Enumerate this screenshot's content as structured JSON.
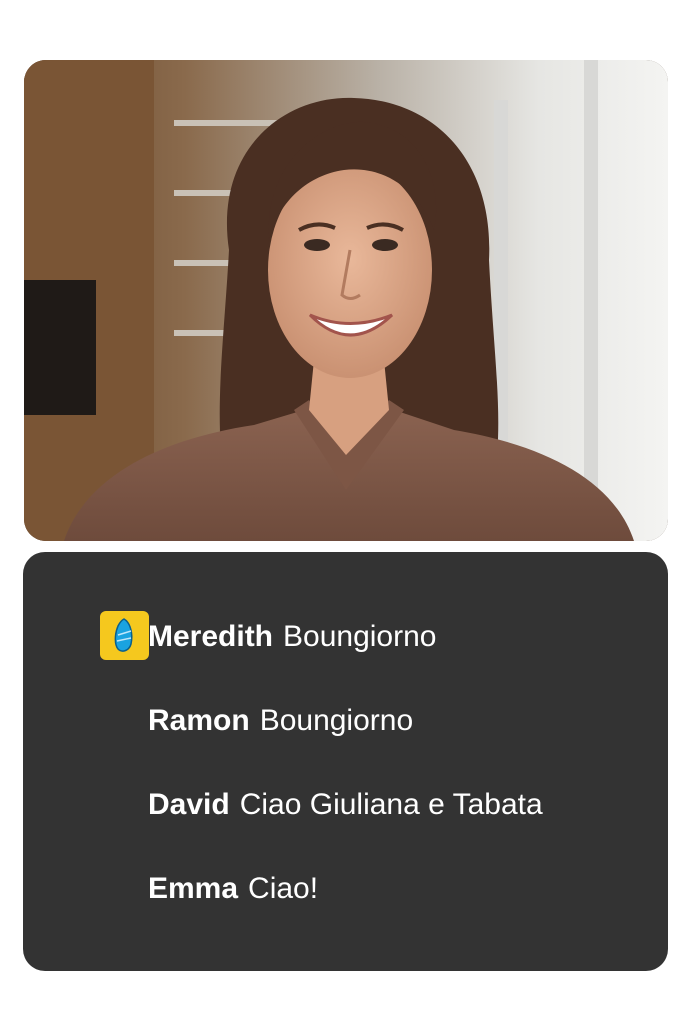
{
  "video": {
    "participant_image": "smiling-woman-video-feed"
  },
  "chat": {
    "app_icon": "rosetta-stone-stone-icon",
    "accent_color": "#f5c81e",
    "panel_color": "#333333",
    "messages": [
      {
        "name": "Meredith",
        "text": "Boungiorno"
      },
      {
        "name": "Ramon",
        "text": "Boungiorno"
      },
      {
        "name": "David",
        "text": "Ciao Giuliana e Tabata"
      },
      {
        "name": "Emma",
        "text": "Ciao!"
      }
    ]
  }
}
